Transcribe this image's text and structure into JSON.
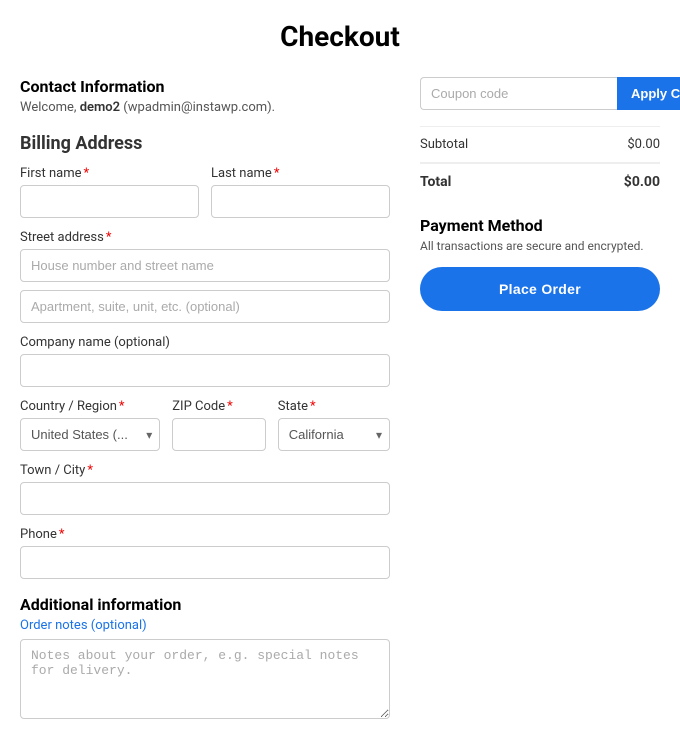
{
  "page": {
    "title": "Checkout"
  },
  "contact": {
    "section_title": "Contact Information",
    "welcome_text": "Welcome, ",
    "username": "demo2",
    "email": " (wpadmin@instawp.com)."
  },
  "billing": {
    "section_title": "Billing Address",
    "first_name_label": "First name",
    "last_name_label": "Last name",
    "street_address_label": "Street address",
    "street_placeholder": "House number and street name",
    "apartment_placeholder": "Apartment, suite, unit, etc. (optional)",
    "company_label": "Company name (optional)",
    "country_label": "Country / Region",
    "country_value": "United States (...",
    "zip_label": "ZIP Code",
    "state_label": "State",
    "state_value": "California",
    "town_label": "Town / City",
    "phone_label": "Phone"
  },
  "additional": {
    "section_title": "Additional information",
    "notes_label": "Order notes (optional)",
    "notes_placeholder": "Notes about your order, e.g. special notes for delivery."
  },
  "coupon": {
    "placeholder": "Coupon code",
    "button_label": "Apply Coupon"
  },
  "summary": {
    "subtotal_label": "Subtotal",
    "subtotal_value": "$0.00",
    "total_label": "Total",
    "total_value": "$0.00"
  },
  "payment": {
    "section_title": "Payment Method",
    "secure_text": "All transactions are secure and encrypted.",
    "place_order_label": "Place Order"
  },
  "countries": [
    "United States (..."
  ],
  "states": [
    "California"
  ]
}
